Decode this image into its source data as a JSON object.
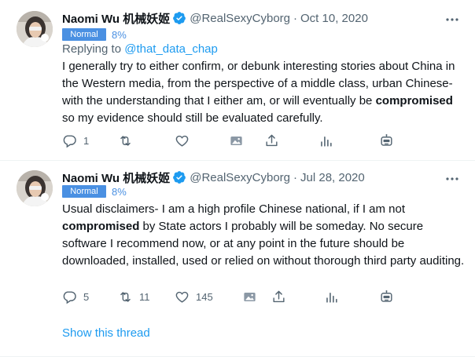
{
  "colors": {
    "link": "#1d9bf0",
    "secondary": "#536471",
    "badge": "#4a90e2",
    "verified": "#1d9bf0"
  },
  "tweets": [
    {
      "name": "Naomi Wu 机械妖姬",
      "handle": "@RealSexyCyborg",
      "separator": "·",
      "date": "Oct 10, 2020",
      "badge": "Normal",
      "percent": "8%",
      "replying_prefix": "Replying to ",
      "replying_handle": "@that_data_chap",
      "text_1": "I generally try to either confirm, or debunk interesting stories about China in the Western media, from the perspective of a middle class, urban Chinese- with the understanding that I either am, or will eventually be ",
      "text_bold": "compromised",
      "text_2": " so my evidence should still be evaluated carefully.",
      "reply_count": "1",
      "retweet_count": "",
      "like_count": ""
    },
    {
      "name": "Naomi Wu 机械妖姬",
      "handle": "@RealSexyCyborg",
      "separator": "·",
      "date": "Jul 28, 2020",
      "badge": "Normal",
      "percent": "8%",
      "text_1": "Usual disclaimers- I am a high profile Chinese national, if I am not ",
      "text_bold": "compromised",
      "text_2": " by State actors I probably will be someday. No secure software I recommend now, or at any point in the future should be downloaded, installed, used or relied on without thorough third party auditing.",
      "reply_count": "5",
      "retweet_count": "11",
      "like_count": "145"
    }
  ],
  "show_thread": "Show this thread",
  "icons": [
    "more-icon",
    "reply-icon",
    "retweet-icon",
    "like-icon",
    "image-icon",
    "share-icon",
    "analytics-icon",
    "bot-icon",
    "verified-icon"
  ]
}
